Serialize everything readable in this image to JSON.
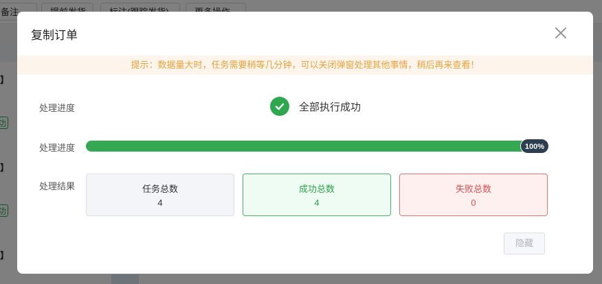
{
  "background": {
    "toolbar_buttons": [
      "备注",
      "提前发货",
      "标注(跟踪发货)",
      "更多操作"
    ],
    "row_marks": [
      "】",
      "】",
      "】"
    ],
    "row_tags": [
      "功",
      "功"
    ]
  },
  "dialog": {
    "title": "复制订单",
    "close_icon": "close-icon",
    "tip": "提示：数据量大时，任务需要稍等几分钟，可以关闭弹窗处理其他事情，稍后再来查看！",
    "status_label": "处理进度",
    "status_text": "全部执行成功",
    "status_icon": "check-circle-icon",
    "progress_label": "处理进度",
    "progress_percent": 100,
    "progress_text": "100%",
    "result_label": "处理结果",
    "stats": {
      "total": {
        "label": "任务总数",
        "value": "4"
      },
      "success": {
        "label": "成功总数",
        "value": "4"
      },
      "fail": {
        "label": "失败总数",
        "value": "0"
      }
    },
    "hide_button": "隐藏"
  },
  "colors": {
    "success": "#34a853",
    "warning": "#e6a23c",
    "danger": "#e24c4c",
    "badge": "#2c3e4f"
  }
}
